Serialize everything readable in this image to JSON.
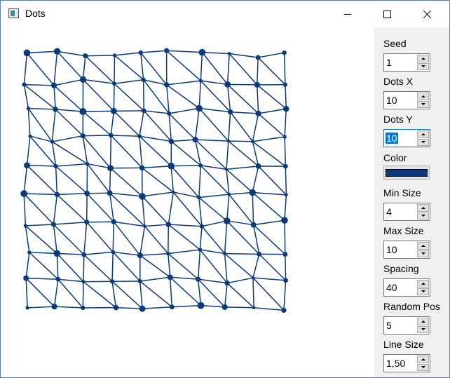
{
  "window": {
    "title": "Dots"
  },
  "titlebar": {
    "minimize_icon": "minimize-icon",
    "maximize_icon": "maximize-icon",
    "close_icon": "close-icon"
  },
  "canvas": {
    "color": "#0b3a78",
    "grid_cols": 10,
    "grid_rows": 10
  },
  "panel": {
    "seed": {
      "label": "Seed",
      "value": "1"
    },
    "dots_x": {
      "label": "Dots X",
      "value": "10"
    },
    "dots_y": {
      "label": "Dots Y",
      "value": "10"
    },
    "color": {
      "label": "Color",
      "value": "#0b3a78"
    },
    "min_size": {
      "label": "Min Size",
      "value": "4"
    },
    "max_size": {
      "label": "Max Size",
      "value": "10"
    },
    "spacing": {
      "label": "Spacing",
      "value": "40"
    },
    "random_pos": {
      "label": "Random Pos",
      "value": "5"
    },
    "line_size": {
      "label": "Line Size",
      "value": "1,50"
    }
  }
}
